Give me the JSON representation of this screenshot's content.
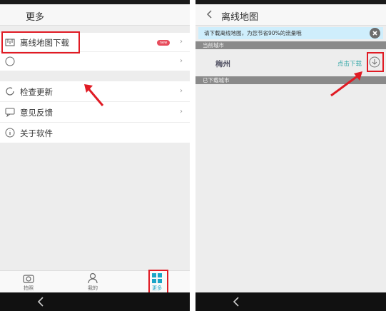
{
  "left": {
    "header_title": "更多",
    "items": [
      {
        "label": "离线地图下载",
        "badge": "new"
      },
      {
        "label": ""
      },
      {
        "label": "检查更新"
      },
      {
        "label": "意见反馈"
      },
      {
        "label": "关于软件"
      }
    ],
    "tabs": [
      {
        "label": "拍照",
        "icon": "camera-icon"
      },
      {
        "label": "我的",
        "icon": "person-icon"
      },
      {
        "label": "更多",
        "icon": "grid-icon"
      }
    ]
  },
  "right": {
    "header_title": "离线地图",
    "notice": "请下载离线地图，为您节省90%的流量哦",
    "current_city_header": "当前城市",
    "current_city": "梅州",
    "download_label": "点击下载",
    "downloaded_header": "已下载城市"
  },
  "colors": {
    "highlight": "#e01b24",
    "download_text": "#35a8a8",
    "notice_bg": "#cfeefc"
  }
}
